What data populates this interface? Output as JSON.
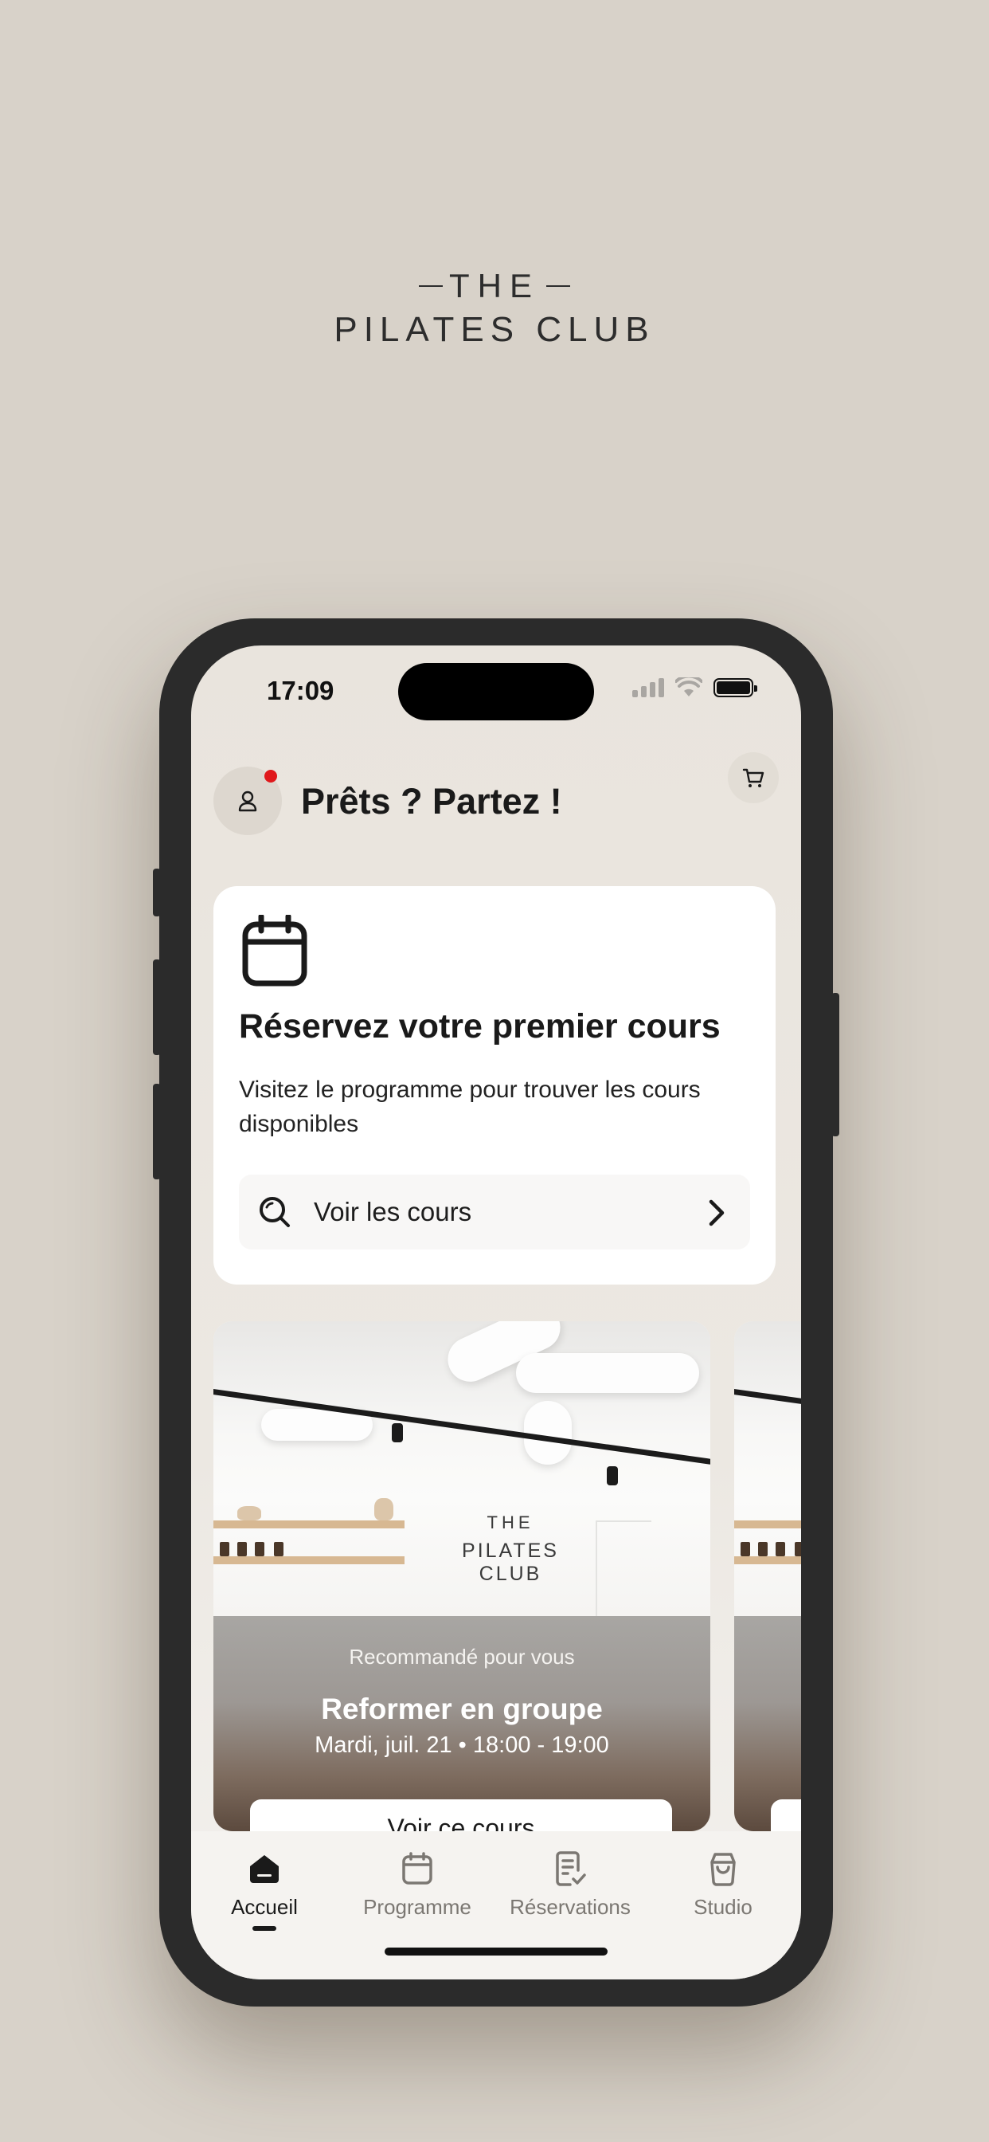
{
  "brand": {
    "line1": "THE",
    "line2": "PILATES CLUB"
  },
  "status": {
    "time": "17:09"
  },
  "header": {
    "greeting": "Prêts ? Partez !"
  },
  "booking_card": {
    "title": "Réservez votre premier cours",
    "description": "Visitez le programme pour trouver les cours disponibles",
    "button_label": "Voir les cours"
  },
  "recommendation": {
    "subtitle": "Recommandé pour vous",
    "title": "Reformer en groupe",
    "datetime": "Mardi, juil. 21 • 18:00 - 19:00",
    "button_label": "Voir ce cours",
    "wall_logo_line1": "THE",
    "wall_logo_line2": "PILATES CLUB"
  },
  "tabs": [
    {
      "label": "Accueil",
      "icon": "home-icon",
      "active": true
    },
    {
      "label": "Programme",
      "icon": "calendar-icon",
      "active": false
    },
    {
      "label": "Réservations",
      "icon": "receipt-check-icon",
      "active": false
    },
    {
      "label": "Studio",
      "icon": "shopping-bag-icon",
      "active": false
    }
  ],
  "colors": {
    "background": "#d8d2c9",
    "notification": "#e0181b",
    "phone_frame": "#2b2b2b"
  }
}
